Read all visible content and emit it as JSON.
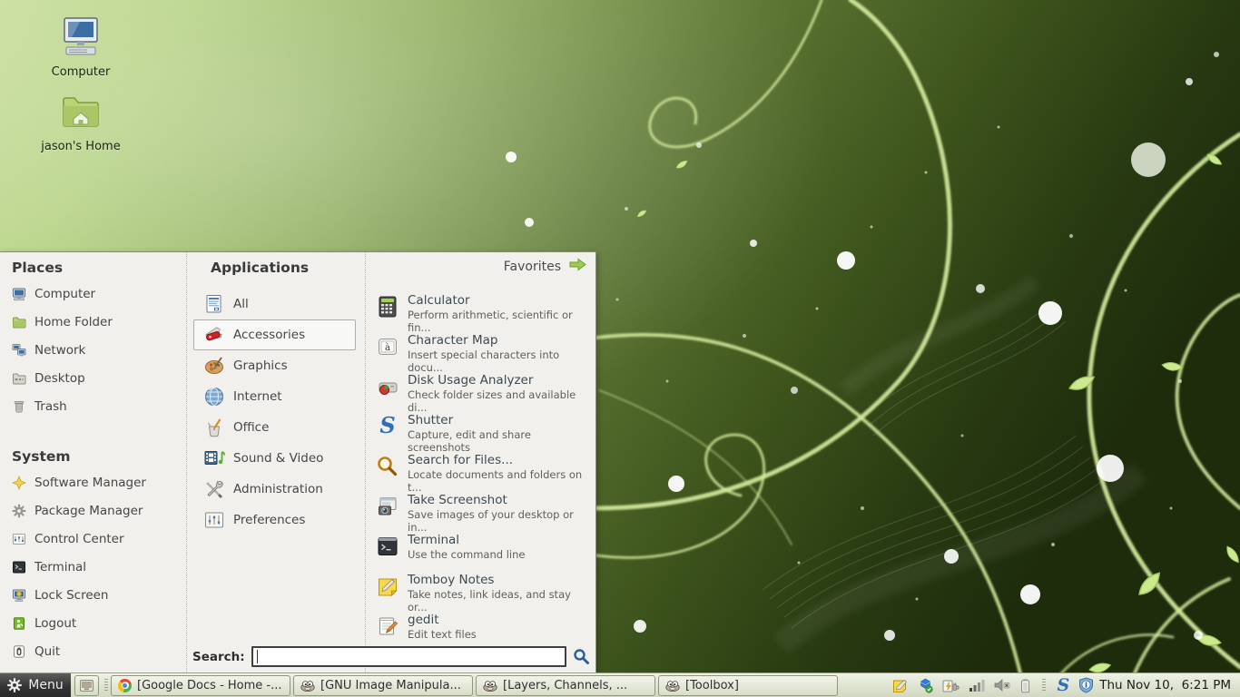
{
  "colors": {
    "accent_green": "#9ccc52",
    "menu_bg": "#f1f0ec",
    "menu_border": "#878d76",
    "selection_border": "#aeaea6",
    "taskbar_bg": "#dde2d0",
    "menu_button_bg": "#333333",
    "wallpaper_light": "#cfe4a2",
    "wallpaper_dark": "#1f2c0c"
  },
  "desktop": {
    "icons": [
      {
        "label": "Computer",
        "icon": "computer-desktop-icon"
      },
      {
        "label": "jason's Home",
        "icon": "home-folder-desktop-icon"
      }
    ]
  },
  "menu": {
    "places": {
      "title": "Places",
      "items": [
        {
          "label": "Computer",
          "icon": "computer-icon"
        },
        {
          "label": "Home Folder",
          "icon": "home-folder-icon"
        },
        {
          "label": "Network",
          "icon": "network-icon"
        },
        {
          "label": "Desktop",
          "icon": "desktop-folder-icon"
        },
        {
          "label": "Trash",
          "icon": "trash-icon"
        }
      ]
    },
    "system": {
      "title": "System",
      "items": [
        {
          "label": "Software Manager",
          "icon": "software-manager-icon"
        },
        {
          "label": "Package Manager",
          "icon": "package-manager-icon"
        },
        {
          "label": "Control Center",
          "icon": "control-center-icon"
        },
        {
          "label": "Terminal",
          "icon": "terminal-icon"
        },
        {
          "label": "Lock Screen",
          "icon": "lock-screen-icon"
        },
        {
          "label": "Logout",
          "icon": "logout-icon"
        },
        {
          "label": "Quit",
          "icon": "quit-icon"
        }
      ]
    },
    "applications": {
      "title": "Applications",
      "favorites_label": "Favorites",
      "categories": [
        {
          "label": "All",
          "icon": "all-categories-icon",
          "selected": false
        },
        {
          "label": "Accessories",
          "icon": "accessories-icon",
          "selected": true
        },
        {
          "label": "Graphics",
          "icon": "graphics-icon",
          "selected": false
        },
        {
          "label": "Internet",
          "icon": "internet-icon",
          "selected": false
        },
        {
          "label": "Office",
          "icon": "office-icon",
          "selected": false
        },
        {
          "label": "Sound & Video",
          "icon": "sound-video-icon",
          "selected": false
        },
        {
          "label": "Administration",
          "icon": "administration-icon",
          "selected": false
        },
        {
          "label": "Preferences",
          "icon": "preferences-icon",
          "selected": false
        }
      ]
    },
    "apps": [
      {
        "name": "Calculator",
        "description": "Perform arithmetic, scientific or fin...",
        "icon": "calculator-icon"
      },
      {
        "name": "Character Map",
        "description": "Insert special characters into docu...",
        "icon": "character-map-icon"
      },
      {
        "name": "Disk Usage Analyzer",
        "description": "Check folder sizes and available di...",
        "icon": "disk-usage-icon"
      },
      {
        "name": "Shutter",
        "description": "Capture, edit and share screenshots",
        "icon": "shutter-icon"
      },
      {
        "name": "Search for Files...",
        "description": "Locate documents and folders on t...",
        "icon": "search-files-icon"
      },
      {
        "name": "Take Screenshot",
        "description": "Save images of your desktop or in...",
        "icon": "take-screenshot-icon"
      },
      {
        "name": "Terminal",
        "description": "Use the command line",
        "icon": "terminal-app-icon"
      },
      {
        "name": "Tomboy Notes",
        "description": "Take notes, link ideas, and stay or...",
        "icon": "tomboy-notes-icon"
      },
      {
        "name": "gedit",
        "description": "Edit text files",
        "icon": "gedit-icon"
      }
    ],
    "search": {
      "label": "Search:",
      "value": "",
      "placeholder": ""
    }
  },
  "taskbar": {
    "menu_label": "Menu",
    "windows": [
      "[Google Docs - Home -...",
      "[GNU Image Manipula...",
      "[Layers, Channels, ...",
      "[Toolbox]"
    ],
    "tray_icons": [
      "tomboy-note",
      "dropbox",
      "power-manager",
      "network-signal",
      "volume-muted",
      "battery",
      "shutter",
      "update-shield"
    ],
    "clock": "Thu Nov 10,  6:21 PM"
  }
}
